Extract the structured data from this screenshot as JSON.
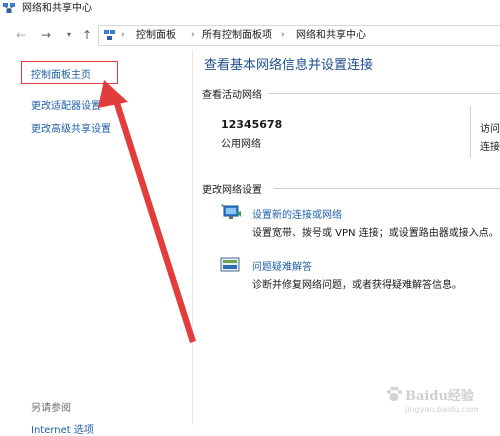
{
  "window": {
    "title": "网络和共享中心"
  },
  "address_bar": {
    "crumbs": [
      "控制面板",
      "所有控制面板项",
      "网络和共享中心"
    ],
    "separator": "›"
  },
  "sidebar": {
    "home": "控制面板主页",
    "adapter": "更改适配器设置",
    "advanced": "更改高级共享设置",
    "see_also": "另请参阅",
    "bottom_link": "Internet 选项"
  },
  "main": {
    "title": "查看基本网络信息并设置连接",
    "active_networks": {
      "heading": "查看活动网络",
      "network_name": "12345678",
      "network_type": "公用网络",
      "access_label": "访问",
      "connection_label": "连接"
    },
    "change_settings": {
      "heading": "更改网络设置",
      "setup": {
        "link": "设置新的连接或网络",
        "desc": "设置宽带、拨号或 VPN 连接；或设置路由器或接入点。"
      },
      "troubleshoot": {
        "link": "问题疑难解答",
        "desc": "诊断并修复网络问题，或者获得疑难解答信息。"
      }
    }
  },
  "annotation": {
    "color": "#e23c3c"
  },
  "watermark": {
    "brand": "Baidu经验",
    "sub": "jingyan.baidu.com"
  }
}
